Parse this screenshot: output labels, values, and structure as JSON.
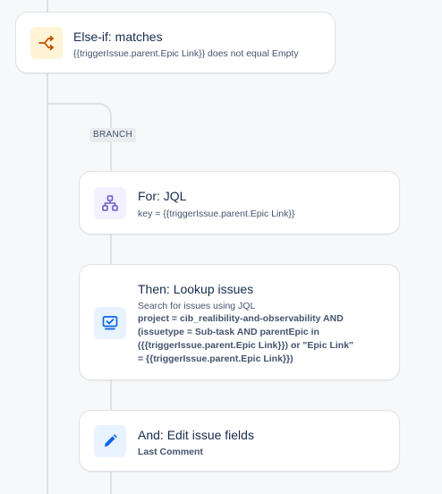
{
  "else_if": {
    "title": "Else-if: matches",
    "detail": "{{triggerIssue.parent.Epic Link}} does not equal Empty",
    "icon": "branch-icon"
  },
  "branch_label": "BRANCH",
  "for_jql": {
    "title": "For: JQL",
    "detail": "key = {{triggerIssue.parent.Epic Link}}",
    "icon": "hierarchy-icon"
  },
  "lookup": {
    "title": "Then: Lookup issues",
    "detail": "Search for issues using JQL",
    "jql": "project = cib_realibility-and-observability AND (issuetype = Sub-task AND parentEpic in ({{triggerIssue.parent.Epic Link}}) or \"Epic Link\" = {{triggerIssue.parent.Epic Link}})",
    "icon": "monitor-check-icon"
  },
  "edit": {
    "title": "And: Edit issue fields",
    "detail": "Last Comment",
    "icon": "pencil-icon"
  },
  "colors": {
    "condition_icon_bg": "#fff4d6",
    "condition_icon_fg": "#c25100",
    "branch_icon_bg": "#f3f0ff",
    "branch_icon_fg": "#6e5dc6",
    "action_icon_bg": "#e9f2ff",
    "action_icon_fg": "#0c66e4"
  }
}
